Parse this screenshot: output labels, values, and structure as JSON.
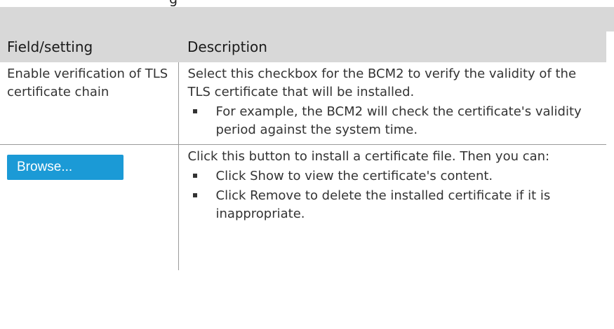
{
  "fragment": {
    "text": "g"
  },
  "table": {
    "headers": {
      "field": "Field/setting",
      "description": "Description"
    },
    "rows": [
      {
        "field_text": "Enable verification of TLS certificate chain",
        "description": "Select this checkbox for the BCM2 to verify the validity of the TLS certificate that will be installed.",
        "bullets": [
          "For example, the BCM2 will check the certificate's validity period against the system time."
        ]
      },
      {
        "field_button_label": "Browse...",
        "description": "Click this button to install a certificate file. Then you can:",
        "bullets": [
          "Click Show to view the certificate's content.",
          "Click Remove to delete the installed certificate if it is inappropriate."
        ]
      }
    ]
  }
}
